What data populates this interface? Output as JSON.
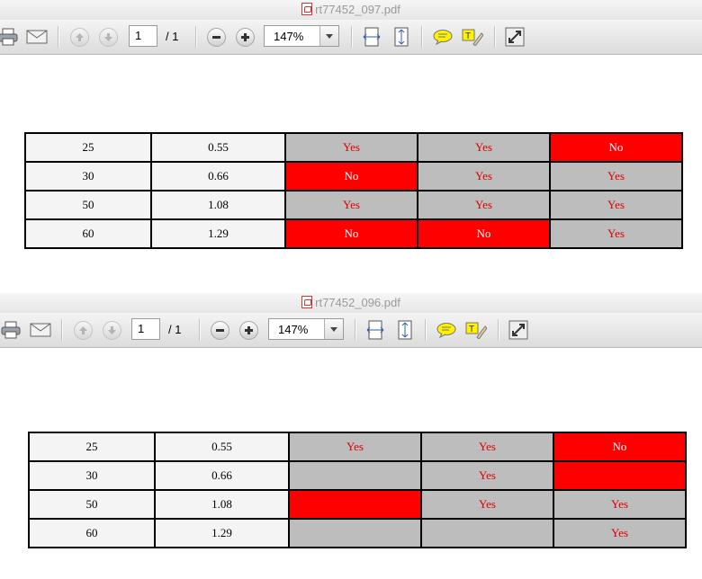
{
  "windows": [
    {
      "title": "rt77452_097.pdf",
      "toolbar": {
        "page_current": "1",
        "page_total": "/ 1",
        "zoom": "147%"
      },
      "table": [
        {
          "a": "25",
          "b": "0.55",
          "cells": [
            {
              "text": "Yes",
              "color": "gray"
            },
            {
              "text": "Yes",
              "color": "gray"
            },
            {
              "text": "No",
              "color": "red"
            }
          ]
        },
        {
          "a": "30",
          "b": "0.66",
          "cells": [
            {
              "text": "No",
              "color": "red"
            },
            {
              "text": "Yes",
              "color": "gray"
            },
            {
              "text": "Yes",
              "color": "gray"
            }
          ]
        },
        {
          "a": "50",
          "b": "1.08",
          "cells": [
            {
              "text": "Yes",
              "color": "gray"
            },
            {
              "text": "Yes",
              "color": "gray"
            },
            {
              "text": "Yes",
              "color": "gray"
            }
          ]
        },
        {
          "a": "60",
          "b": "1.29",
          "cells": [
            {
              "text": "No",
              "color": "red"
            },
            {
              "text": "No",
              "color": "red"
            },
            {
              "text": "Yes",
              "color": "gray"
            }
          ]
        }
      ]
    },
    {
      "title": "rt77452_096.pdf",
      "toolbar": {
        "page_current": "1",
        "page_total": "/ 1",
        "zoom": "147%"
      },
      "table": [
        {
          "a": "25",
          "b": "0.55",
          "cells": [
            {
              "text": "Yes",
              "color": "gray"
            },
            {
              "text": "Yes",
              "color": "gray"
            },
            {
              "text": "No",
              "color": "red"
            }
          ]
        },
        {
          "a": "30",
          "b": "0.66",
          "cells": [
            {
              "text": "",
              "color": "gray"
            },
            {
              "text": "Yes",
              "color": "gray"
            },
            {
              "text": "",
              "color": "red"
            }
          ]
        },
        {
          "a": "50",
          "b": "1.08",
          "cells": [
            {
              "text": "",
              "color": "red"
            },
            {
              "text": "Yes",
              "color": "gray"
            },
            {
              "text": "Yes",
              "color": "gray"
            }
          ]
        },
        {
          "a": "60",
          "b": "1.29",
          "cells": [
            {
              "text": "",
              "color": "gray"
            },
            {
              "text": "",
              "color": "gray"
            },
            {
              "text": "Yes",
              "color": "gray"
            }
          ]
        }
      ]
    }
  ],
  "colors": {
    "cell_gray": "#bdbdbd",
    "cell_red": "#ff0000",
    "text_red": "#e00000",
    "label_bg": "#f4f4f4"
  },
  "icons": [
    "pdf-file-icon",
    "print-icon",
    "mail-icon",
    "previous-page-icon",
    "next-page-icon",
    "zoom-out-icon",
    "zoom-in-icon",
    "fit-width-icon",
    "fit-page-icon",
    "comment-icon",
    "highlight-text-icon",
    "fullscreen-icon"
  ]
}
